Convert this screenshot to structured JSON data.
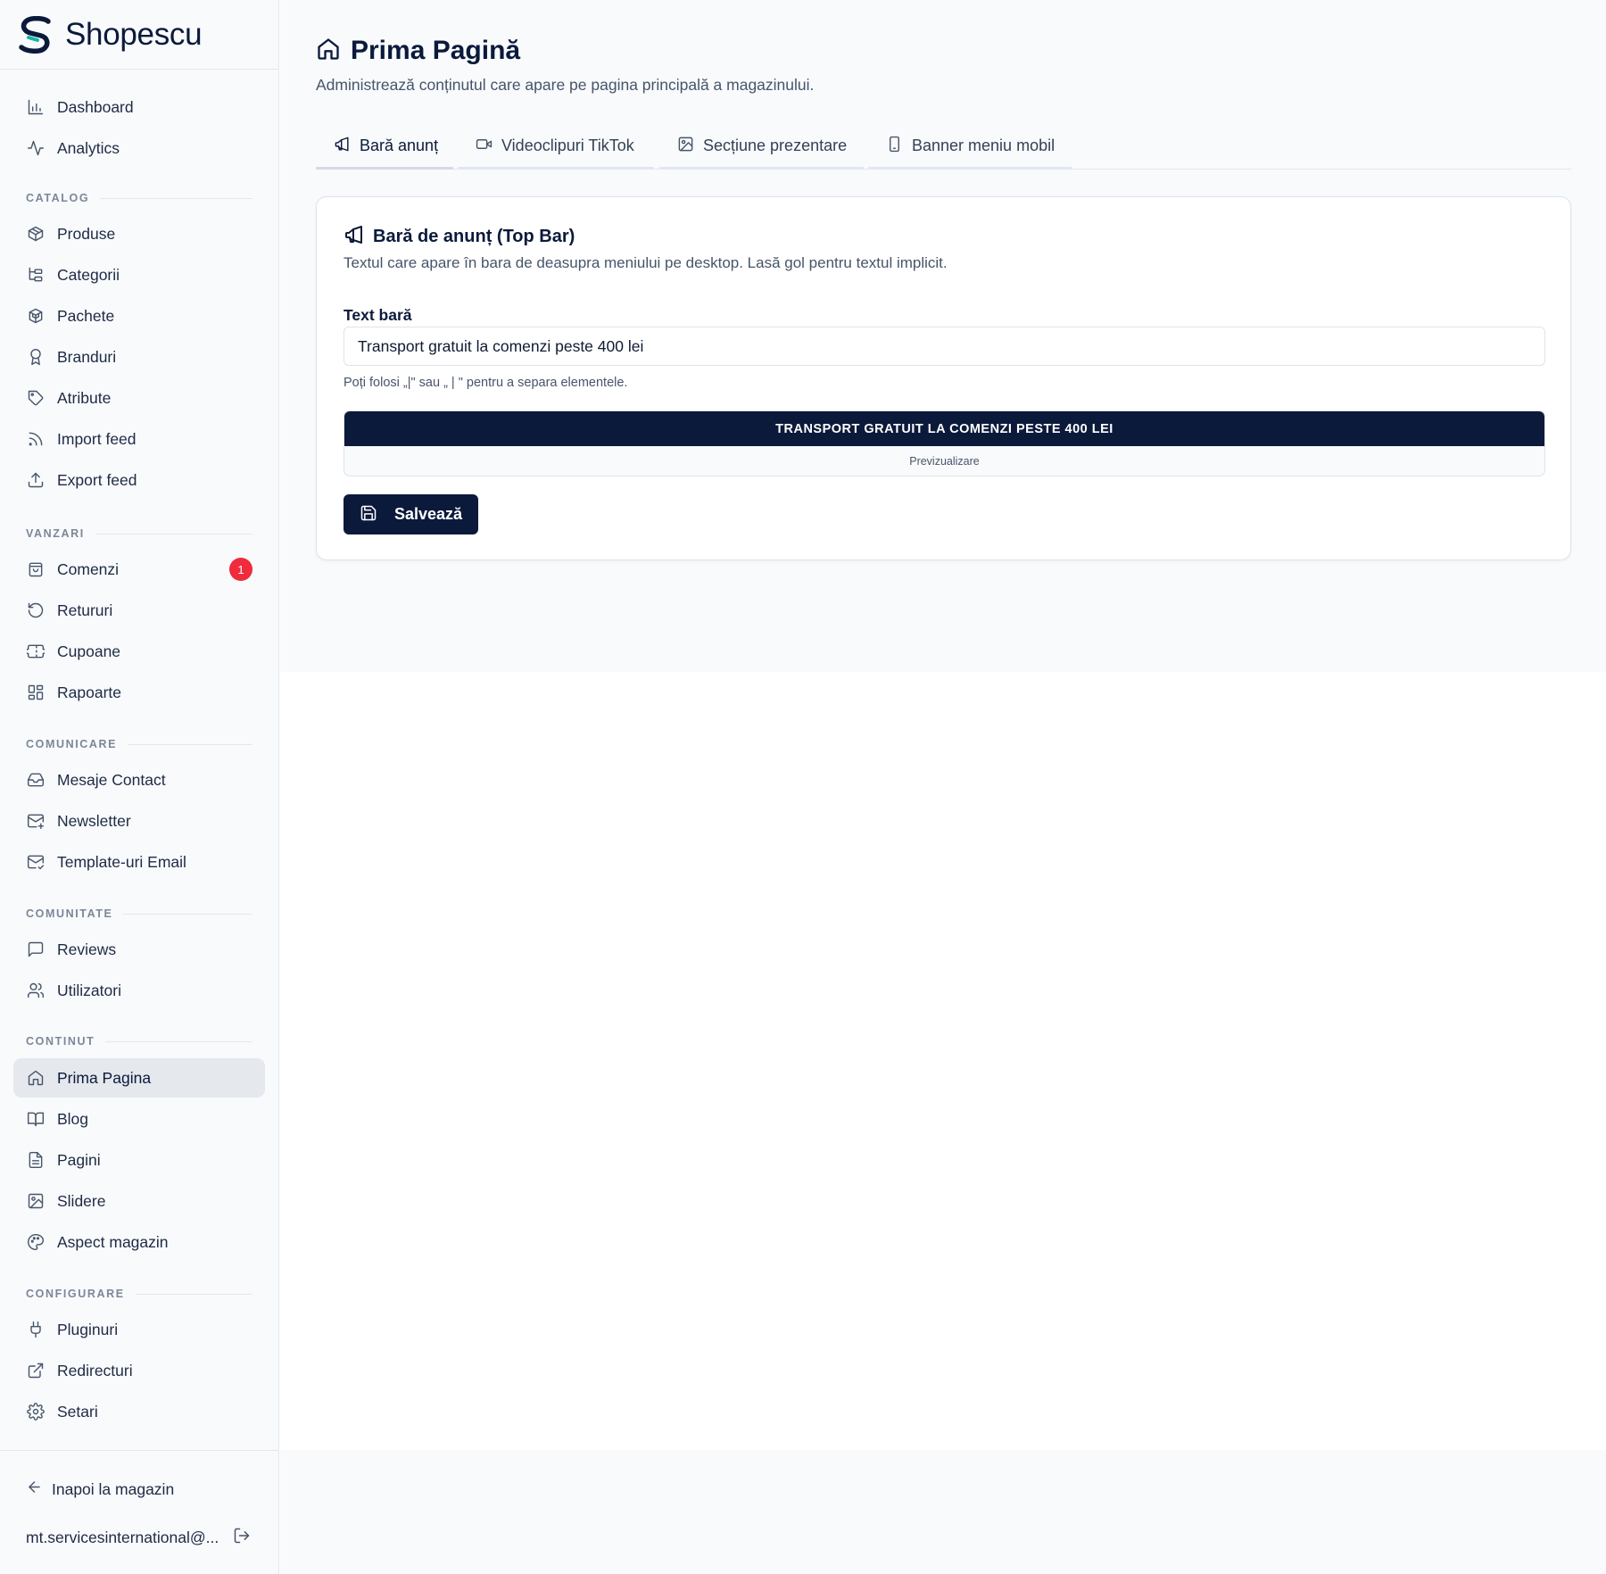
{
  "brand": {
    "name": "Shopescu"
  },
  "colors": {
    "primary": "#0b1a3b",
    "badge": "#ef2b3c",
    "background": "#f8fafc",
    "active_item_bg": "#e5e8ec"
  },
  "sidebar": {
    "top_items": [
      {
        "label": "Dashboard",
        "icon": "bar-chart-icon"
      },
      {
        "label": "Analytics",
        "icon": "activity-icon"
      }
    ],
    "sections": {
      "catalog": {
        "title": "CATALOG",
        "items": [
          {
            "label": "Produse",
            "icon": "package-icon"
          },
          {
            "label": "Categorii",
            "icon": "folder-tree-icon"
          },
          {
            "label": "Pachete",
            "icon": "boxes-icon"
          },
          {
            "label": "Branduri",
            "icon": "award-icon"
          },
          {
            "label": "Atribute",
            "icon": "tag-icon"
          },
          {
            "label": "Import feed",
            "icon": "rss-icon"
          },
          {
            "label": "Export feed",
            "icon": "upload-icon"
          }
        ]
      },
      "vanzari": {
        "title": "VANZARI",
        "items": [
          {
            "label": "Comenzi",
            "icon": "shopping-bag-icon",
            "badge": "1"
          },
          {
            "label": "Retururi",
            "icon": "rotate-ccw-icon"
          },
          {
            "label": "Cupoane",
            "icon": "ticket-icon"
          },
          {
            "label": "Rapoarte",
            "icon": "layout-grid-icon"
          }
        ]
      },
      "comunicare": {
        "title": "COMUNICARE",
        "items": [
          {
            "label": "Mesaje Contact",
            "icon": "inbox-icon"
          },
          {
            "label": "Newsletter",
            "icon": "mail-plus-icon"
          },
          {
            "label": "Template-uri Email",
            "icon": "mail-check-icon"
          }
        ]
      },
      "comunitate": {
        "title": "COMUNITATE",
        "items": [
          {
            "label": "Reviews",
            "icon": "message-square-icon"
          },
          {
            "label": "Utilizatori",
            "icon": "users-icon"
          }
        ]
      },
      "continut": {
        "title": "CONTINUT",
        "items": [
          {
            "label": "Prima Pagina",
            "icon": "home-icon",
            "active": true
          },
          {
            "label": "Blog",
            "icon": "book-open-icon"
          },
          {
            "label": "Pagini",
            "icon": "file-text-icon"
          },
          {
            "label": "Slidere",
            "icon": "image-icon"
          },
          {
            "label": "Aspect magazin",
            "icon": "palette-icon"
          }
        ]
      },
      "configurare": {
        "title": "CONFIGURARE",
        "items": [
          {
            "label": "Pluginuri",
            "icon": "plug-icon"
          },
          {
            "label": "Redirecturi",
            "icon": "external-link-icon"
          },
          {
            "label": "Setari",
            "icon": "settings-icon"
          }
        ]
      }
    },
    "footer": {
      "back_label": "Inapoi la magazin",
      "user_email": "mt.servicesinternational@..."
    }
  },
  "main": {
    "title": "Prima Pagină",
    "subtitle": "Administrează conținutul care apare pe pagina principală a magazinului.",
    "tabs": [
      {
        "label": "Bară anunț",
        "icon": "megaphone-icon",
        "active": true
      },
      {
        "label": "Videoclipuri TikTok",
        "icon": "video-icon"
      },
      {
        "label": "Secțiune prezentare",
        "icon": "image-icon"
      },
      {
        "label": "Banner meniu mobil",
        "icon": "smartphone-icon"
      }
    ],
    "card": {
      "title": "Bară de anunț (Top Bar)",
      "description": "Textul care apare în bara de deasupra meniului pe desktop. Lasă gol pentru textul implicit.",
      "field_label": "Text bară",
      "field_value": "Transport gratuit la comenzi peste 400 lei",
      "hint": "Poți folosi „|\" sau „ | \" pentru a separa elementele.",
      "preview_text": "TRANSPORT GRATUIT LA COMENZI PESTE 400 LEI",
      "preview_caption": "Previzualizare",
      "save_label": "Salvează"
    }
  }
}
